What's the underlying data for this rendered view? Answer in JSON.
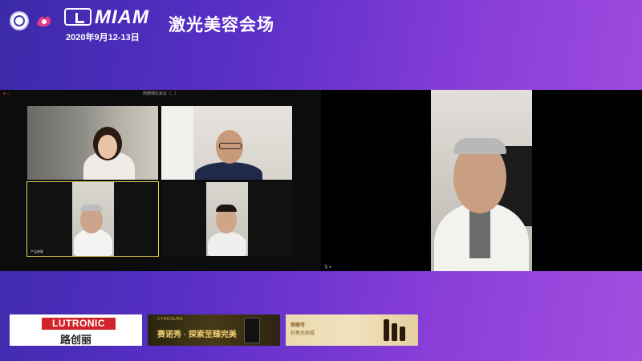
{
  "header": {
    "brand_name": "MIAM",
    "event_date": "2020年9月12-13日",
    "venue_title": "激光美容会场"
  },
  "meeting_window": {
    "title": "芮德博达会议（...）",
    "participants": [
      {
        "label": ""
      },
      {
        "label": ""
      },
      {
        "label": "产品经理"
      },
      {
        "label": ""
      }
    ]
  },
  "sponsors": {
    "lutronic": {
      "name": "LUTRONIC",
      "name_cn": "路创丽"
    },
    "cynosure": {
      "brand": "CYNOSURE",
      "slogan": "赛诺秀 · 探索至臻完美"
    },
    "skincare": {
      "line1": "修丽可",
      "line2": "抗氧化权威"
    }
  },
  "icons": [
    "university-logo-icon",
    "flower-logo-icon",
    "miam-logo-icon",
    "mic-icon",
    "video-icon"
  ]
}
